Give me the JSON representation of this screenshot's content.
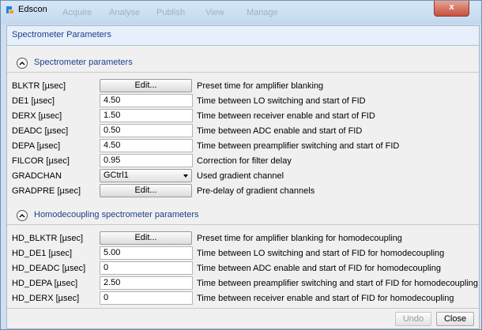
{
  "window": {
    "title": "Edscon",
    "close_glyph": "x",
    "ghost_menu": [
      "Acquire",
      "Analyse",
      "Publish",
      "View",
      "Manage"
    ]
  },
  "header": {
    "title": "Spectrometer Parameters"
  },
  "sections": [
    {
      "title": "Spectrometer parameters",
      "rows": [
        {
          "label": "BLKTR [µsec]",
          "type": "button",
          "value": "Edit...",
          "description": "Preset time for amplifier blanking"
        },
        {
          "label": "DE1 [µsec]",
          "type": "input",
          "value": "4.50",
          "description": "Time between LO switching and start of FID"
        },
        {
          "label": "DERX [µsec]",
          "type": "input",
          "value": "1.50",
          "description": "Time between receiver enable and start of FID"
        },
        {
          "label": "DEADC [µsec]",
          "type": "input",
          "value": "0.50",
          "description": "Time between ADC enable and start of FID"
        },
        {
          "label": "DEPA [µsec]",
          "type": "input",
          "value": "4.50",
          "description": "Time between preamplifier switching and start of FID"
        },
        {
          "label": "FILCOR [µsec]",
          "type": "input",
          "value": "0.95",
          "description": "Correction for filter delay"
        },
        {
          "label": "GRADCHAN",
          "type": "select",
          "value": "GCtrl1",
          "description": "Used gradient channel"
        },
        {
          "label": "GRADPRE [µsec]",
          "type": "button",
          "value": "Edit...",
          "description": "Pre-delay of gradient channels"
        }
      ]
    },
    {
      "title": "Homodecoupling spectrometer parameters",
      "rows": [
        {
          "label": "HD_BLKTR [µsec]",
          "type": "button",
          "value": "Edit...",
          "description": "Preset time for amplifier blanking for homodecoupling"
        },
        {
          "label": "HD_DE1 [µsec]",
          "type": "input",
          "value": "5.00",
          "description": "Time between LO switching and start of FID for homodecoupling"
        },
        {
          "label": "HD_DEADC [µsec]",
          "type": "input",
          "value": "0",
          "description": "Time between ADC enable and start of FID for homodecoupling"
        },
        {
          "label": "HD_DEPA [µsec]",
          "type": "input",
          "value": "2.50",
          "description": "Time between preamplifier switching and start of FID for homodecoupling"
        },
        {
          "label": "HD_DERX [µsec]",
          "type": "input",
          "value": "0",
          "description": "Time between receiver enable and start of FID for homodecoupling"
        }
      ]
    }
  ],
  "footer": {
    "undo_label": "Undo",
    "close_label": "Close"
  }
}
